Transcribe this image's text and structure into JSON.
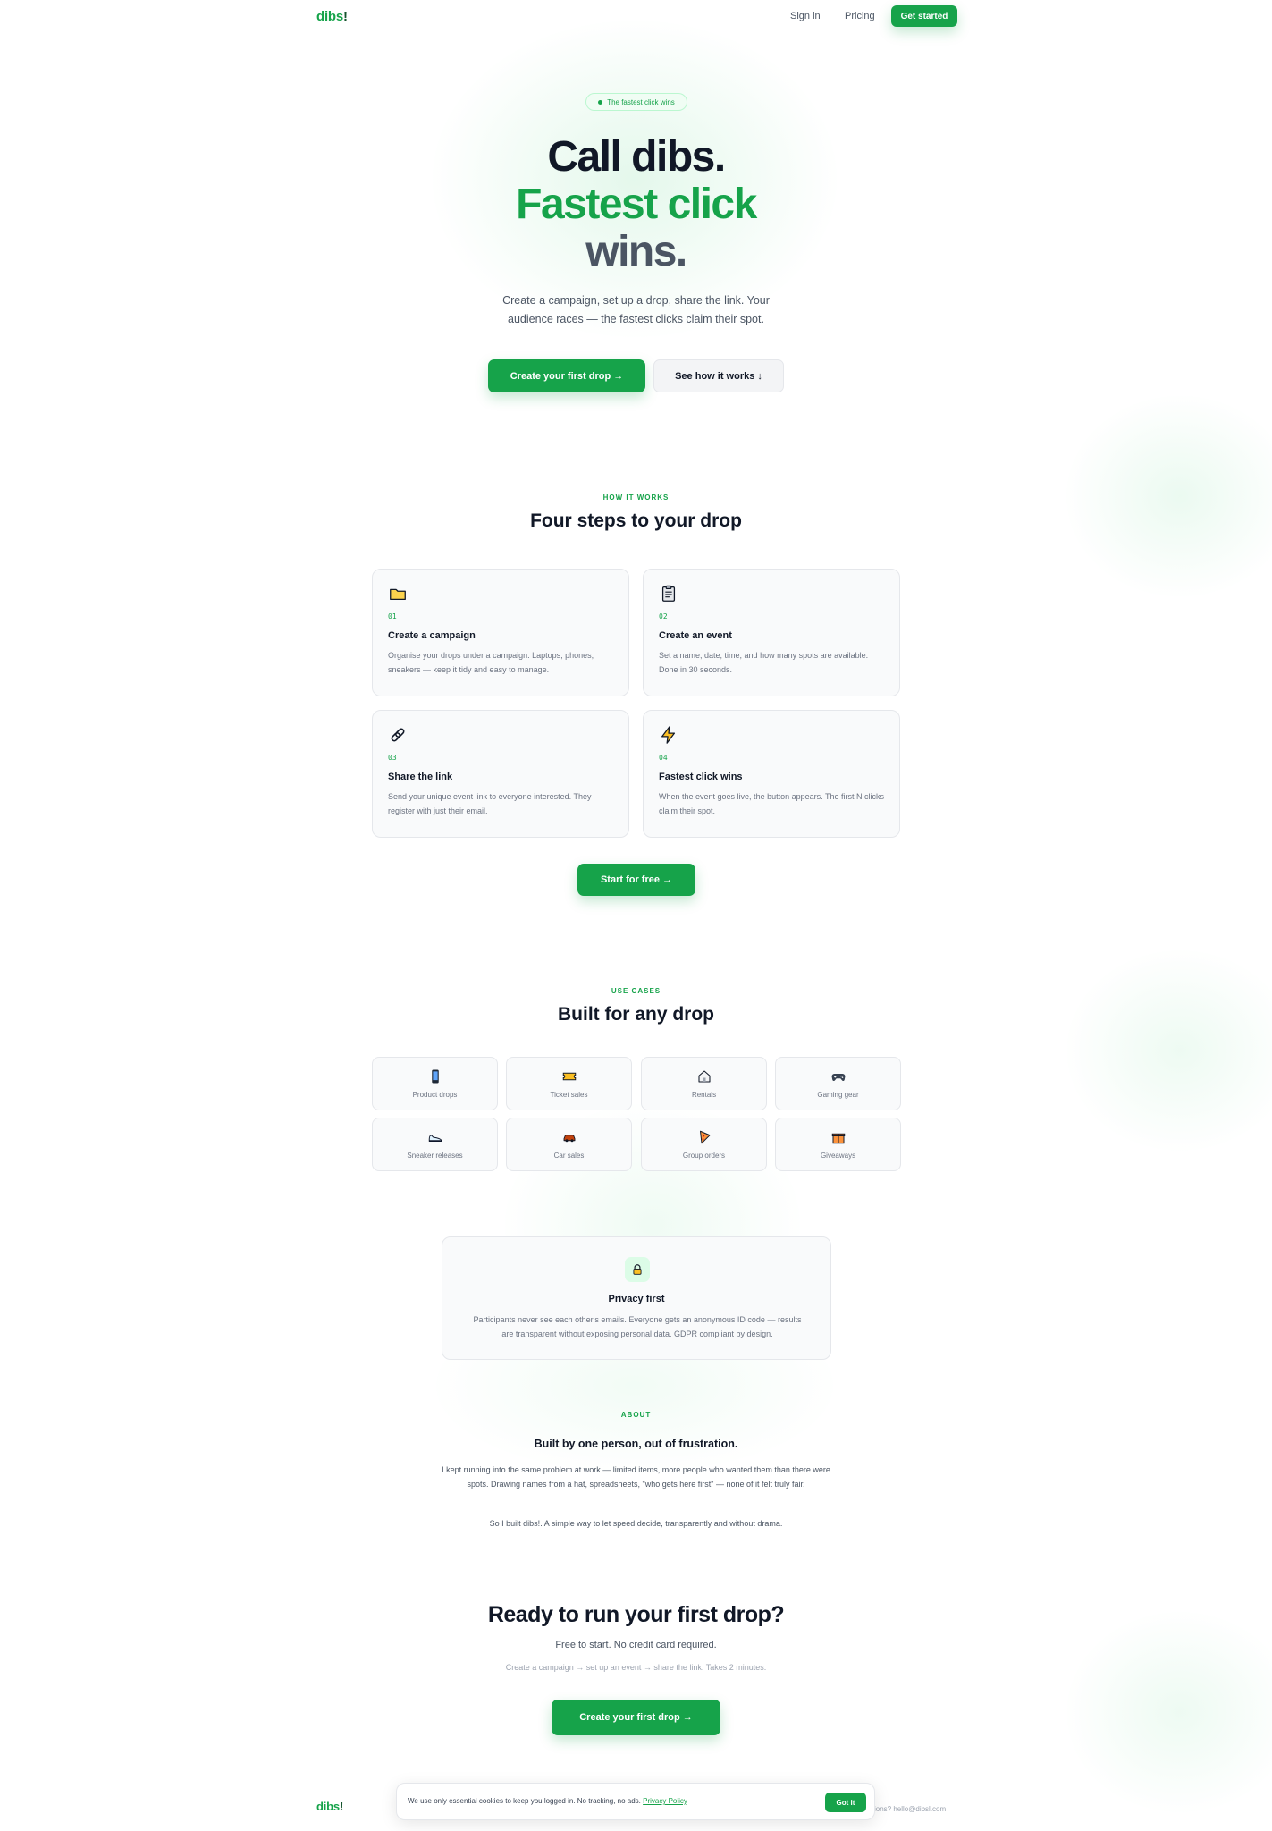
{
  "nav": {
    "logo": "dibs",
    "logo_mark": "!",
    "sign_in": "Sign in",
    "pricing": "Pricing",
    "get_started": "Get started"
  },
  "hero": {
    "pill": "The fastest click wins",
    "line1": "Call dibs.",
    "line2": "Fastest click",
    "line3": "wins.",
    "subtitle": "Create a campaign, set up a drop, share the link. Your audience races — the fastest clicks claim their spot.",
    "primary_cta": "Create your first drop →",
    "secondary_cta": "See how it works ↓"
  },
  "how": {
    "eyebrow": "HOW IT WORKS",
    "title": "Four steps to your drop",
    "steps": [
      {
        "num": "01",
        "title": "Create a campaign",
        "desc": "Organise your drops under a campaign. Laptops, phones, sneakers — keep it tidy and easy to manage.",
        "icon": "folder-icon"
      },
      {
        "num": "02",
        "title": "Create an event",
        "desc": "Set a name, date, time, and how many spots are available. Done in 30 seconds.",
        "icon": "clipboard-icon"
      },
      {
        "num": "03",
        "title": "Share the link",
        "desc": "Send your unique event link to everyone interested. They register with just their email.",
        "icon": "link-icon"
      },
      {
        "num": "04",
        "title": "Fastest click wins",
        "desc": "When the event goes live, the button appears. The first N clicks claim their spot.",
        "icon": "lightning-icon"
      }
    ],
    "cta": "Start for free →"
  },
  "use_cases": {
    "eyebrow": "USE CASES",
    "title": "Built for any drop",
    "items": [
      {
        "label": "Product drops",
        "icon": "phone-icon"
      },
      {
        "label": "Ticket sales",
        "icon": "ticket-icon"
      },
      {
        "label": "Rentals",
        "icon": "house-icon"
      },
      {
        "label": "Gaming gear",
        "icon": "gamepad-icon"
      },
      {
        "label": "Sneaker releases",
        "icon": "sneaker-icon"
      },
      {
        "label": "Car sales",
        "icon": "car-icon"
      },
      {
        "label": "Group orders",
        "icon": "pizza-icon"
      },
      {
        "label": "Giveaways",
        "icon": "gift-icon"
      }
    ]
  },
  "privacy": {
    "icon": "lock-icon",
    "title": "Privacy first",
    "desc": "Participants never see each other's emails. Everyone gets an anonymous ID code — results are transparent without exposing personal data. GDPR compliant by design."
  },
  "about": {
    "eyebrow": "ABOUT",
    "title": "Built by one person, out of frustration.",
    "p1": "I kept running into the same problem at work — limited items, more people who wanted them than there were spots. Drawing names from a hat, spreadsheets, \"who gets here first\" — none of it felt truly fair.",
    "p2": "So I built dibs!. A simple way to let speed decide, transparently and without drama."
  },
  "cta": {
    "title": "Ready to run your first drop?",
    "subtitle": "Free to start. No credit card required.",
    "steps": "Create a campaign → set up an event → share the link. Takes 2 minutes.",
    "button": "Create your first drop →"
  },
  "footer": {
    "logo": "dibs",
    "logo_mark": "!",
    "contact": "ions? hello@dibsl.com"
  },
  "cookie": {
    "text": "We use only essential cookies to keep you logged in. No tracking, no ads.",
    "link": "Privacy Policy",
    "button": "Got it"
  },
  "colors": {
    "brand": "#16a34a",
    "text": "#111827",
    "muted": "#6b7280"
  }
}
